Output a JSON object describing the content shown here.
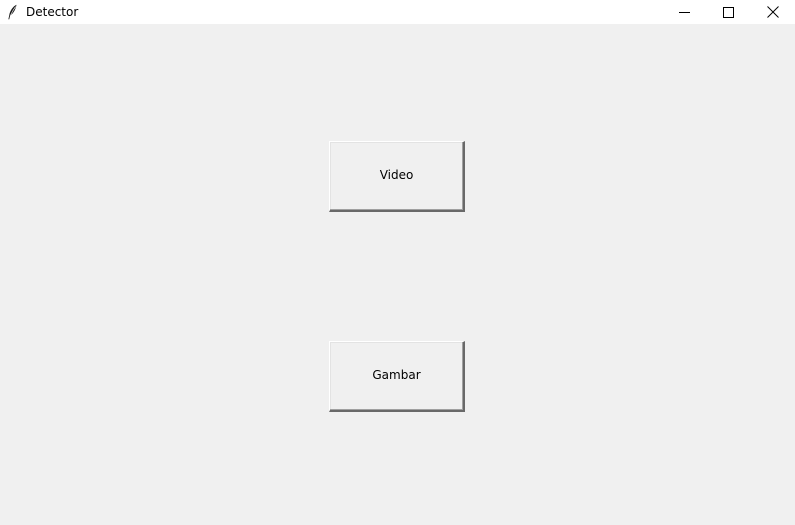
{
  "window": {
    "title": "Detector",
    "icon": "feather-icon",
    "controls": {
      "minimize": "minimize-icon",
      "maximize": "maximize-icon",
      "close": "close-icon"
    }
  },
  "buttons": {
    "video_label": "Video",
    "gambar_label": "Gambar"
  },
  "colors": {
    "background": "#f0f0f0",
    "titlebar": "#ffffff"
  }
}
